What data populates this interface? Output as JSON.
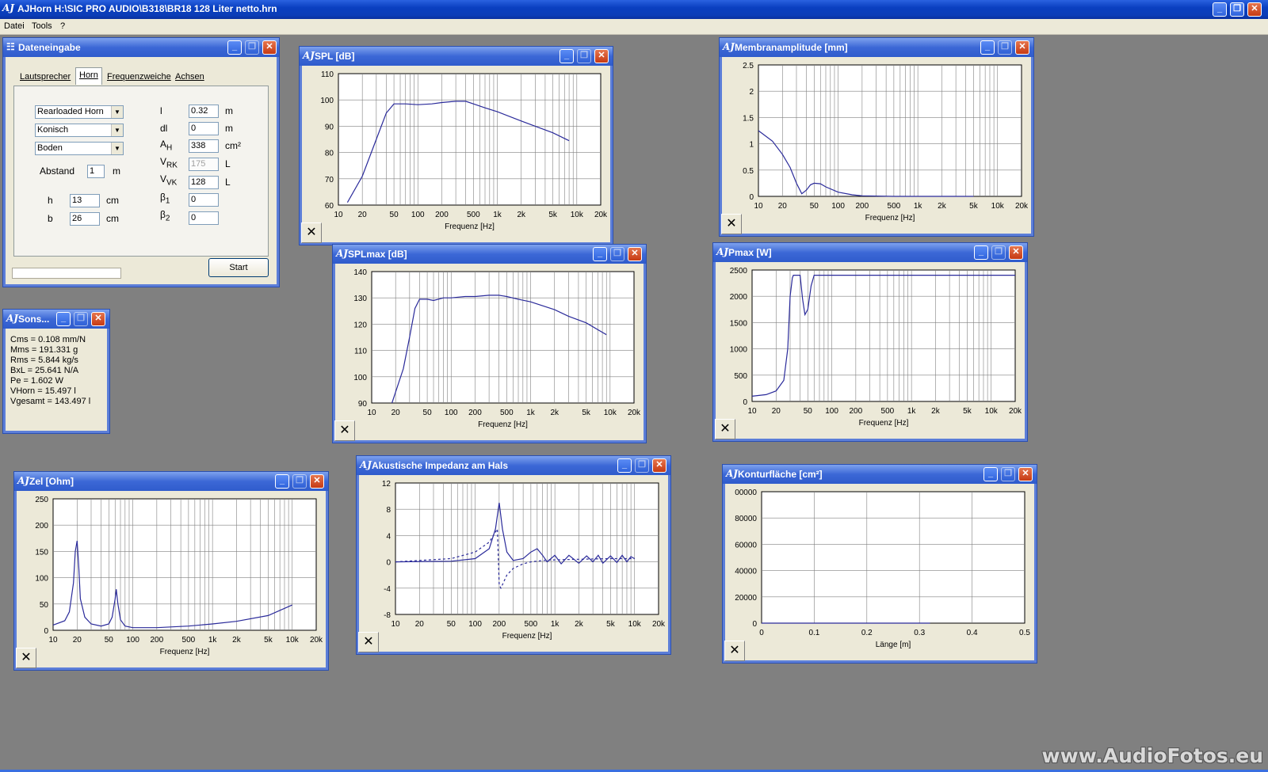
{
  "app": {
    "title": "AJHorn  H:\\SIC PRO AUDIO\\B318\\BR18 128 Liter netto.hrn",
    "logo": "AJ",
    "minimize": "_",
    "restore": "❐",
    "close": "✕"
  },
  "menu": {
    "items": [
      "Datei",
      "Tools",
      "?"
    ]
  },
  "dateneingabe": {
    "title": "Dateneingabe",
    "tabs": [
      "Lautsprecher",
      "Horn",
      "Frequenzweiche",
      "Achsen"
    ],
    "horn_type": "Rearloaded Horn",
    "profile": "Konisch",
    "placement": "Boden",
    "abstand_label": "Abstand",
    "abstand_value": "1",
    "abstand_unit": "m",
    "h_label": "h",
    "h_value": "13",
    "h_unit": "cm",
    "b_label": "b",
    "b_value": "26",
    "b_unit": "cm",
    "l_label": "l",
    "l_value": "0.32",
    "l_unit": "m",
    "dl_label": "dl",
    "dl_value": "0",
    "dl_unit": "m",
    "ah_label": "A",
    "ah_sub": "H",
    "ah_value": "338",
    "ah_unit": "cm²",
    "vrk_label": "V",
    "vrk_sub": "RK",
    "vrk_value": "175",
    "vrk_unit": "L",
    "vvk_label": "V",
    "vvk_sub": "VK",
    "vvk_value": "128",
    "vvk_unit": "L",
    "b1_label": "β",
    "b1_sub": "1",
    "b1_value": "0",
    "b2_label": "β",
    "b2_sub": "2",
    "b2_value": "0",
    "start_label": "Start",
    "progress": 0
  },
  "sonstiges": {
    "title": "Sons...",
    "lines": [
      "Cms = 0.108 mm/N",
      "Mms = 191.331 g",
      "Rms = 5.844 kg/s",
      "BxL = 25.641 N/A",
      "Pe = 1.602 W",
      "VHorn = 15.497 l",
      "Vgesamt = 143.497 l"
    ]
  },
  "close_x": "✕",
  "freq_ticks": [
    "10",
    "20",
    "50",
    "100",
    "200",
    "500",
    "1k",
    "2k",
    "5k",
    "10k",
    "20k"
  ],
  "freq_xlabel": "Frequenz [Hz]",
  "windows": {
    "spl": {
      "title": "SPL [dB]"
    },
    "splmax": {
      "title": "SPLmax [dB]"
    },
    "membran": {
      "title": "Membranamplitude [mm]"
    },
    "pmax": {
      "title": "Pmax [W]"
    },
    "zel": {
      "title": "Zel [Ohm]"
    },
    "akust": {
      "title": "Akustische Impedanz am Hals"
    },
    "kontur": {
      "title": "Konturfläche [cm²]"
    }
  },
  "chart_data": [
    {
      "id": "spl",
      "type": "line",
      "title": "SPL [dB]",
      "xlabel": "Frequenz [Hz]",
      "xscale": "log",
      "xlim": [
        10,
        20000
      ],
      "ylim": [
        60,
        110
      ],
      "yticks": [
        "110",
        "100",
        "90",
        "80",
        "70",
        "60"
      ],
      "series": [
        {
          "color": "#2a2a9a",
          "x": [
            13,
            20,
            30,
            40,
            50,
            70,
            100,
            150,
            200,
            300,
            400,
            500,
            700,
            1000,
            2000,
            3000,
            5000,
            8000
          ],
          "y": [
            61,
            71,
            85,
            95,
            98.5,
            98.5,
            98.2,
            98.5,
            99,
            99.5,
            99.5,
            98.5,
            97,
            95.5,
            92,
            90,
            87.5,
            84.5
          ]
        }
      ]
    },
    {
      "id": "splmax",
      "type": "line",
      "title": "SPLmax [dB]",
      "xlabel": "Frequenz [Hz]",
      "xscale": "log",
      "xlim": [
        10,
        20000
      ],
      "ylim": [
        90,
        140
      ],
      "yticks": [
        "140",
        "130",
        "120",
        "110",
        "100",
        "90"
      ],
      "series": [
        {
          "color": "#2a2a9a",
          "x": [
            18,
            25,
            30,
            35,
            40,
            50,
            60,
            80,
            100,
            150,
            200,
            300,
            400,
            500,
            700,
            1000,
            2000,
            3000,
            5000,
            9000
          ],
          "y": [
            90,
            103,
            115,
            126,
            129.5,
            129.5,
            129,
            130,
            130,
            130.5,
            130.5,
            131,
            131,
            130.5,
            129.5,
            128.5,
            125.5,
            123,
            120.5,
            116
          ]
        }
      ]
    },
    {
      "id": "membran",
      "type": "line",
      "title": "Membranamplitude [mm]",
      "xlabel": "Frequenz [Hz]",
      "xscale": "log",
      "xlim": [
        10,
        20000
      ],
      "ylim": [
        0,
        2.5
      ],
      "yticks": [
        "2.5",
        "2",
        "1.5",
        "1",
        "0.5",
        "0"
      ],
      "series": [
        {
          "color": "#2a2a9a",
          "x": [
            10,
            15,
            20,
            25,
            30,
            35,
            40,
            45,
            50,
            60,
            70,
            100,
            150,
            200,
            500,
            1000,
            2000,
            5000
          ],
          "y": [
            1.25,
            1.05,
            0.8,
            0.55,
            0.25,
            0.05,
            0.12,
            0.22,
            0.25,
            0.24,
            0.18,
            0.08,
            0.03,
            0.01,
            0,
            0,
            0,
            0
          ]
        }
      ]
    },
    {
      "id": "pmax",
      "type": "line",
      "title": "Pmax [W]",
      "xlabel": "Frequenz [Hz]",
      "xscale": "log",
      "xlim": [
        10,
        20000
      ],
      "ylim": [
        0,
        2500
      ],
      "yticks": [
        "2500",
        "2000",
        "1500",
        "1000",
        "500",
        "0"
      ],
      "series": [
        {
          "color": "#2a2a9a",
          "x": [
            10,
            15,
            20,
            25,
            28,
            30,
            32,
            33,
            40,
            43,
            46,
            50,
            55,
            60,
            100,
            1000,
            10000,
            20000
          ],
          "y": [
            100,
            130,
            200,
            400,
            1000,
            2000,
            2350,
            2400,
            2400,
            1950,
            1650,
            1750,
            2200,
            2400,
            2400,
            2400,
            2400,
            2400
          ]
        }
      ]
    },
    {
      "id": "zel",
      "type": "line",
      "title": "Zel [Ohm]",
      "xlabel": "Frequenz [Hz]",
      "xscale": "log",
      "xlim": [
        10,
        20000
      ],
      "ylim": [
        0,
        250
      ],
      "yticks": [
        "250",
        "200",
        "150",
        "100",
        "50",
        "0"
      ],
      "series": [
        {
          "color": "#2a2a9a",
          "x": [
            10,
            14,
            16,
            18,
            19,
            20,
            21,
            22,
            25,
            30,
            40,
            50,
            55,
            60,
            62,
            65,
            70,
            80,
            100,
            200,
            500,
            1000,
            2000,
            5000,
            10000
          ],
          "y": [
            10,
            18,
            35,
            90,
            150,
            170,
            120,
            60,
            25,
            12,
            8,
            12,
            25,
            60,
            78,
            50,
            20,
            8,
            5,
            5,
            8,
            12,
            17,
            28,
            48
          ]
        }
      ]
    },
    {
      "id": "akust",
      "type": "line",
      "title": "Akustische Impedanz am Hals",
      "xlabel": "Frequenz [Hz]",
      "xscale": "log",
      "xlim": [
        10,
        20000
      ],
      "ylim": [
        -8,
        12
      ],
      "yticks": [
        "12",
        "8",
        "4",
        "0",
        "-4",
        "-8"
      ],
      "series": [
        {
          "color": "#2a2a9a",
          "x": [
            10,
            50,
            100,
            150,
            180,
            200,
            220,
            250,
            300,
            400,
            500,
            600,
            700,
            800,
            1000,
            1200,
            1500,
            2000,
            2500,
            3000,
            3500,
            4000,
            5000,
            6000,
            7000,
            8000,
            9000,
            10000
          ],
          "y": [
            0,
            0.1,
            0.5,
            2,
            5,
            9,
            5,
            1.5,
            0.2,
            0.5,
            1.5,
            2,
            1,
            0,
            1,
            -0.3,
            1,
            -0.2,
            0.9,
            0,
            1,
            -0.2,
            0.9,
            -0.1,
            1,
            0,
            0.8,
            0.5
          ]
        },
        {
          "color": "#2a2a9a",
          "dashed": true,
          "x": [
            10,
            50,
            100,
            150,
            190,
            200,
            210,
            250,
            300,
            400,
            500,
            700,
            1000,
            2000,
            5000,
            10000
          ],
          "y": [
            0,
            0.5,
            1.5,
            3,
            5,
            -3.5,
            -4,
            -2,
            -1,
            -0.3,
            0,
            0.2,
            0.3,
            0.4,
            0.5,
            0.5
          ]
        }
      ]
    },
    {
      "id": "kontur",
      "type": "line",
      "title": "Konturfläche [cm²]",
      "xlabel": "Länge [m]",
      "xscale": "linear",
      "xlim": [
        0,
        0.5
      ],
      "ylim": [
        0,
        100000
      ],
      "xticks": [
        "0",
        "0.1",
        "0.2",
        "0.3",
        "0.4",
        "0.5"
      ],
      "yticks": [
        "00000",
        "80000",
        "60000",
        "40000",
        "20000",
        "0"
      ],
      "series": [
        {
          "color": "#2a2a9a",
          "x": [
            0,
            0.32
          ],
          "y": [
            0,
            0
          ]
        }
      ]
    }
  ],
  "watermark": "www.AudioFotos.eu"
}
